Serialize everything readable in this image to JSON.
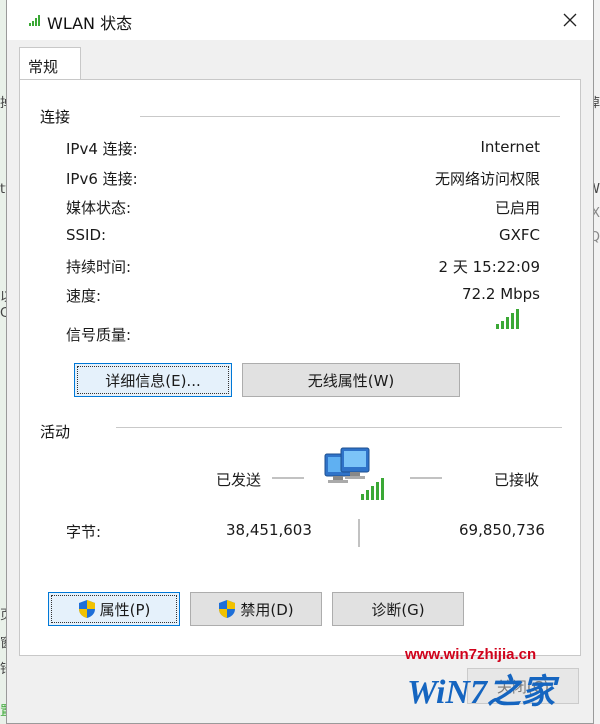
{
  "window": {
    "title": "WLAN 状态",
    "close_label": "✕"
  },
  "tabs": [
    {
      "label": "常规"
    }
  ],
  "connection": {
    "heading": "连接",
    "rows": [
      {
        "label": "IPv4 连接:",
        "value": "Internet"
      },
      {
        "label": "IPv6 连接:",
        "value": "无网络访问权限"
      },
      {
        "label": "媒体状态:",
        "value": "已启用"
      },
      {
        "label": "SSID:",
        "value": "GXFC"
      },
      {
        "label": "持续时间:",
        "value": "2 天 15:22:09"
      },
      {
        "label": "速度:",
        "value": "72.2 Mbps"
      }
    ],
    "signal_label": "信号质量:",
    "signal_bars": 5,
    "details_button": "详细信息(E)...",
    "wireless_props_button": "无线属性(W)"
  },
  "activity": {
    "heading": "活动",
    "sent_label": "已发送",
    "received_label": "已接收",
    "bytes_label": "字节:",
    "bytes_sent": "38,451,603",
    "bytes_received": "69,850,736"
  },
  "buttons": {
    "properties": "属性(P)",
    "disable": "禁用(D)",
    "diagnose": "诊断(G)",
    "close": "关闭(C)"
  },
  "background": {
    "left_fragments": [
      "掉",
      "tv",
      "以",
      "C",
      "页",
      "窗",
      "钎",
      "置"
    ],
    "right_fragments": [
      "掉",
      "W",
      "GX",
      "Q"
    ]
  },
  "watermark": {
    "url": "www.win7zhijia.cn",
    "logo": "WiN7之家"
  },
  "colors": {
    "accent": "#0078d7",
    "signal_green": "#3aa835",
    "button_face": "#e1e1e1"
  }
}
